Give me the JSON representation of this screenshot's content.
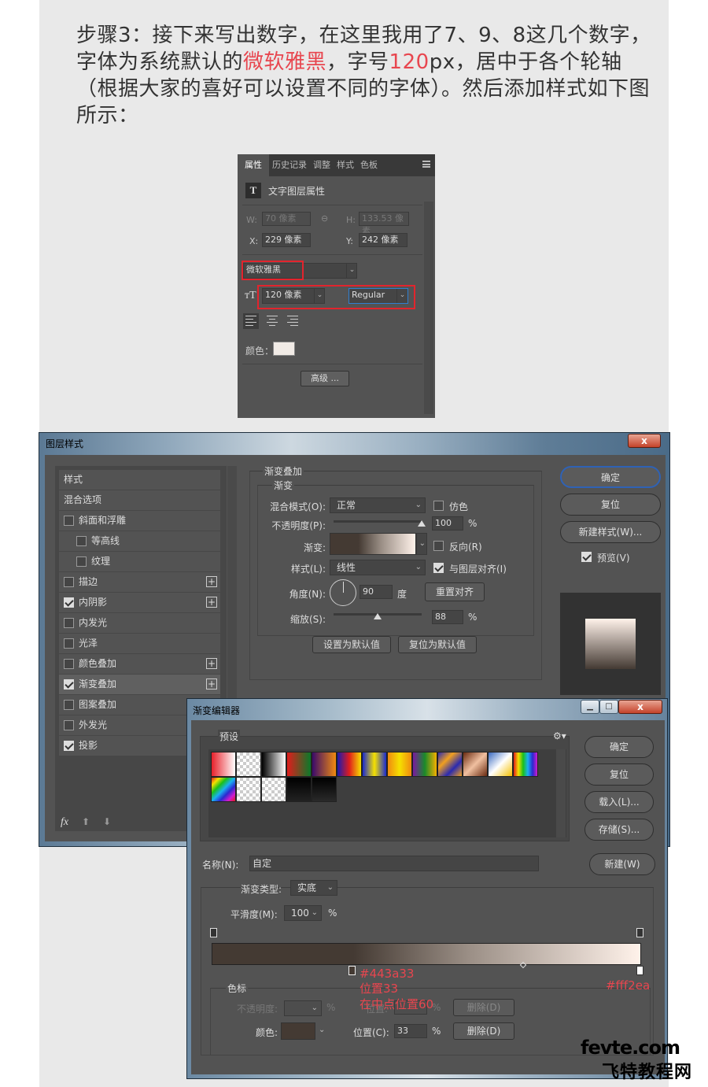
{
  "intro": {
    "part1": "步骤3：接下来写出数字，在这里我用了7、9、8这几个数字，字体为系统默认的",
    "font_name": "微软雅黑",
    "part2": "，字号",
    "font_size": "120",
    "part3": "px，居中于各个轮轴（根据大家的喜好可以设置不同的字体）。然后添加样式如下图所示："
  },
  "properties_panel": {
    "tabs": [
      "属性",
      "历史记录",
      "调整",
      "样式",
      "色板"
    ],
    "section_title": "文字图层属性",
    "w_label": "W:",
    "w_value": "70 像素",
    "h_label": "H:",
    "h_value": "133.53 像素",
    "x_label": "X:",
    "x_value": "229 像素",
    "y_label": "Y:",
    "y_value": "242 像素",
    "font_family": "微软雅黑",
    "font_size": "120 像素",
    "font_style": "Regular",
    "color_label": "颜色：",
    "color_value": "#f1ebe6",
    "advanced_button": "高级 ..."
  },
  "layer_style": {
    "title": "图层样式",
    "close": "x",
    "list": [
      {
        "label": "样式",
        "checkbox": false,
        "checked": false,
        "plus": false
      },
      {
        "label": "混合选项",
        "checkbox": false,
        "checked": false,
        "plus": false
      },
      {
        "label": "斜面和浮雕",
        "checkbox": true,
        "checked": false,
        "plus": false
      },
      {
        "label": "等高线",
        "checkbox": true,
        "checked": false,
        "plus": false
      },
      {
        "label": "纹理",
        "checkbox": true,
        "checked": false,
        "plus": false
      },
      {
        "label": "描边",
        "checkbox": true,
        "checked": false,
        "plus": true
      },
      {
        "label": "内阴影",
        "checkbox": true,
        "checked": true,
        "plus": true
      },
      {
        "label": "内发光",
        "checkbox": true,
        "checked": false,
        "plus": false
      },
      {
        "label": "光泽",
        "checkbox": true,
        "checked": false,
        "plus": false
      },
      {
        "label": "颜色叠加",
        "checkbox": true,
        "checked": false,
        "plus": true
      },
      {
        "label": "渐变叠加",
        "checkbox": true,
        "checked": true,
        "plus": true
      },
      {
        "label": "图案叠加",
        "checkbox": true,
        "checked": false,
        "plus": false
      },
      {
        "label": "外发光",
        "checkbox": true,
        "checked": false,
        "plus": false
      },
      {
        "label": "投影",
        "checkbox": true,
        "checked": true,
        "plus": false
      }
    ],
    "fx_label": "fx",
    "group_title": "渐变叠加",
    "sub_title": "渐变",
    "blend_mode_label": "混合模式(O):",
    "blend_mode_value": "正常",
    "dither_label": "仿色",
    "opacity_label": "不透明度(P):",
    "opacity_value": "100",
    "opacity_unit": "%",
    "opacity_level": 1.0,
    "gradient_label": "渐变:",
    "reverse_label": "反向(R)",
    "style_label": "样式(L):",
    "style_value": "线性",
    "align_label": "与图层对齐(I)",
    "angle_label": "角度(N):",
    "angle_value": "90",
    "angle_unit": "度",
    "reset_align_button": "重置对齐",
    "scale_label": "缩放(S):",
    "scale_value": "88",
    "scale_unit": "%",
    "set_default_button": "设置为默认值",
    "reset_default_button": "复位为默认值",
    "ok_button": "确定",
    "reset_button": "复位",
    "new_style_button": "新建样式(W)...",
    "preview_label": "预览(V)"
  },
  "gradient_editor": {
    "title": "渐变编辑器",
    "presets_label": "预设",
    "ok_button": "确定",
    "reset_button": "复位",
    "load_button": "载入(L)...",
    "save_button": "存储(S)...",
    "name_label": "名称(N):",
    "name_value": "自定",
    "new_button": "新建(W)",
    "type_label": "渐变类型:",
    "type_value": "实底",
    "smooth_label": "平滑度(M):",
    "smooth_value": "100",
    "smooth_unit": "%",
    "stop_color_start": "#443a33",
    "stop_color_end": "#fff2ea",
    "stops_group": "色标",
    "opacity_label": "不透明度:",
    "opacity_unit": "%",
    "pos_label_dim": "位置:",
    "pos_unit_dim": "%",
    "delete_dim": "删除(D)",
    "color_label": "颜色:",
    "color_value": "#443a33",
    "pos_label": "位置(C):",
    "pos_value": "33",
    "pos_unit": "%",
    "delete_button": "删除(D)"
  },
  "annotations": {
    "color_left": "#443a33",
    "position": "位置33",
    "midpoint": "在中点位置60",
    "color_right": "#fff2ea"
  },
  "watermark": {
    "line1": "fevte.com",
    "line2": "飞特教程网"
  }
}
